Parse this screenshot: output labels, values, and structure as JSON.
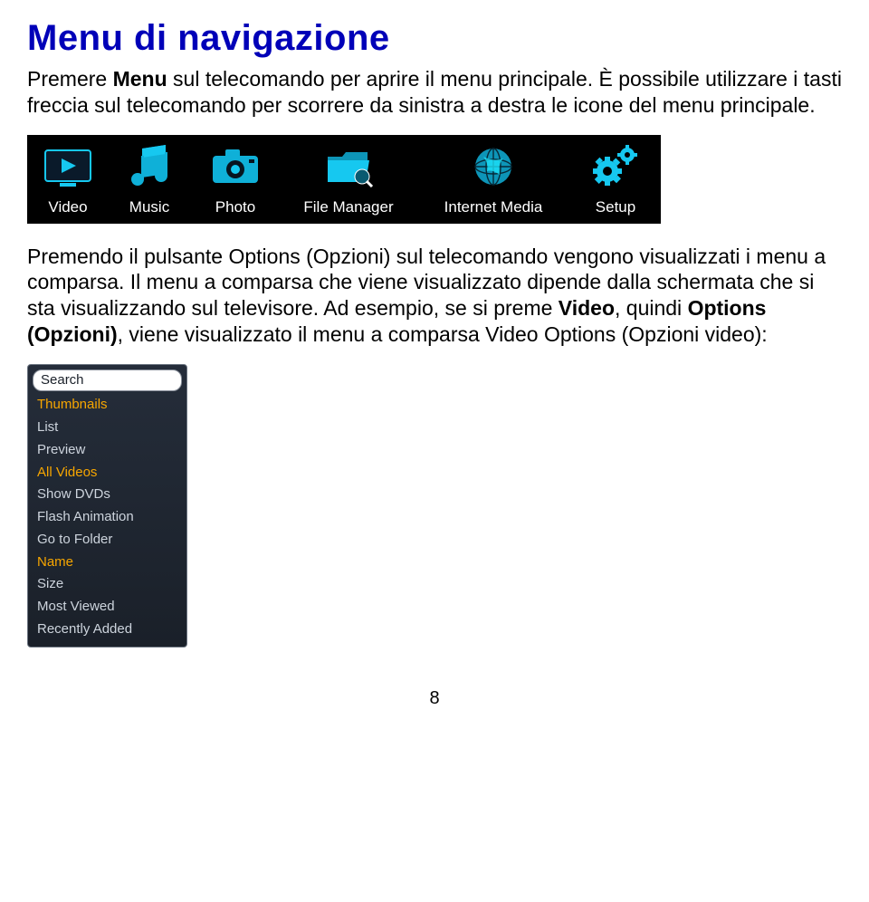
{
  "title": "Menu di navigazione",
  "para1_part1": "Premere ",
  "para1_bold1": "Menu",
  "para1_part2": " sul telecomando per aprire il menu principale. È possibile utilizzare i tasti freccia sul telecomando per scorrere da sinistra a destra le icone del menu principale.",
  "menu": {
    "video": "Video",
    "music": "Music",
    "photo": "Photo",
    "filemanager": "File Manager",
    "internetmedia": "Internet Media",
    "setup": "Setup"
  },
  "para2_part1": "Premendo il pulsante Options (Opzioni) sul telecomando vengono visualizzati i menu a comparsa. Il menu a comparsa che viene visualizzato dipende dalla schermata che si sta visualizzando sul televisore. Ad esempio, se si preme ",
  "para2_bold1": "Video",
  "para2_part2": ", quindi ",
  "para2_bold2": "Options (Opzioni)",
  "para2_part3": ", viene visualizzato il menu a comparsa Video Options (Opzioni video):",
  "popup": {
    "items": [
      {
        "label": "Search",
        "state": "selected"
      },
      {
        "label": "Thumbnails",
        "state": "highlight"
      },
      {
        "label": "List",
        "state": ""
      },
      {
        "label": "Preview",
        "state": ""
      },
      {
        "label": "All Videos",
        "state": "highlight"
      },
      {
        "label": "Show DVDs",
        "state": ""
      },
      {
        "label": "Flash Animation",
        "state": ""
      },
      {
        "label": "Go to Folder",
        "state": ""
      },
      {
        "label": "Name",
        "state": "highlight"
      },
      {
        "label": "Size",
        "state": ""
      },
      {
        "label": "Most Viewed",
        "state": ""
      },
      {
        "label": "Recently Added",
        "state": ""
      }
    ]
  },
  "page_number": "8",
  "colors": {
    "heading": "#0000B8",
    "accent": "#16c8f0",
    "popup_highlight": "#f7a600"
  }
}
